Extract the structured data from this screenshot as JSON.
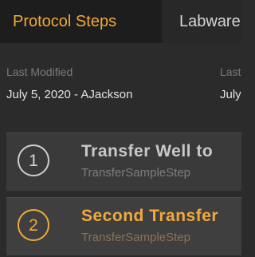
{
  "tabs": [
    {
      "label": "Protocol Steps",
      "active": true
    },
    {
      "label": "Labware",
      "active": false
    }
  ],
  "meta": {
    "modified_label": "Last Modified",
    "modified_value": "July 5, 2020 - AJackson",
    "second_label": "Last",
    "second_value": "July"
  },
  "steps": [
    {
      "number": "1",
      "title": "Transfer Well to",
      "subtitle": "TransferSampleStep",
      "selected": false
    },
    {
      "number": "2",
      "title": "Second Transfer",
      "subtitle": "TransferSampleStep",
      "selected": true
    }
  ],
  "colors": {
    "accent": "#f2a93b",
    "background": "#2b2b2b"
  }
}
